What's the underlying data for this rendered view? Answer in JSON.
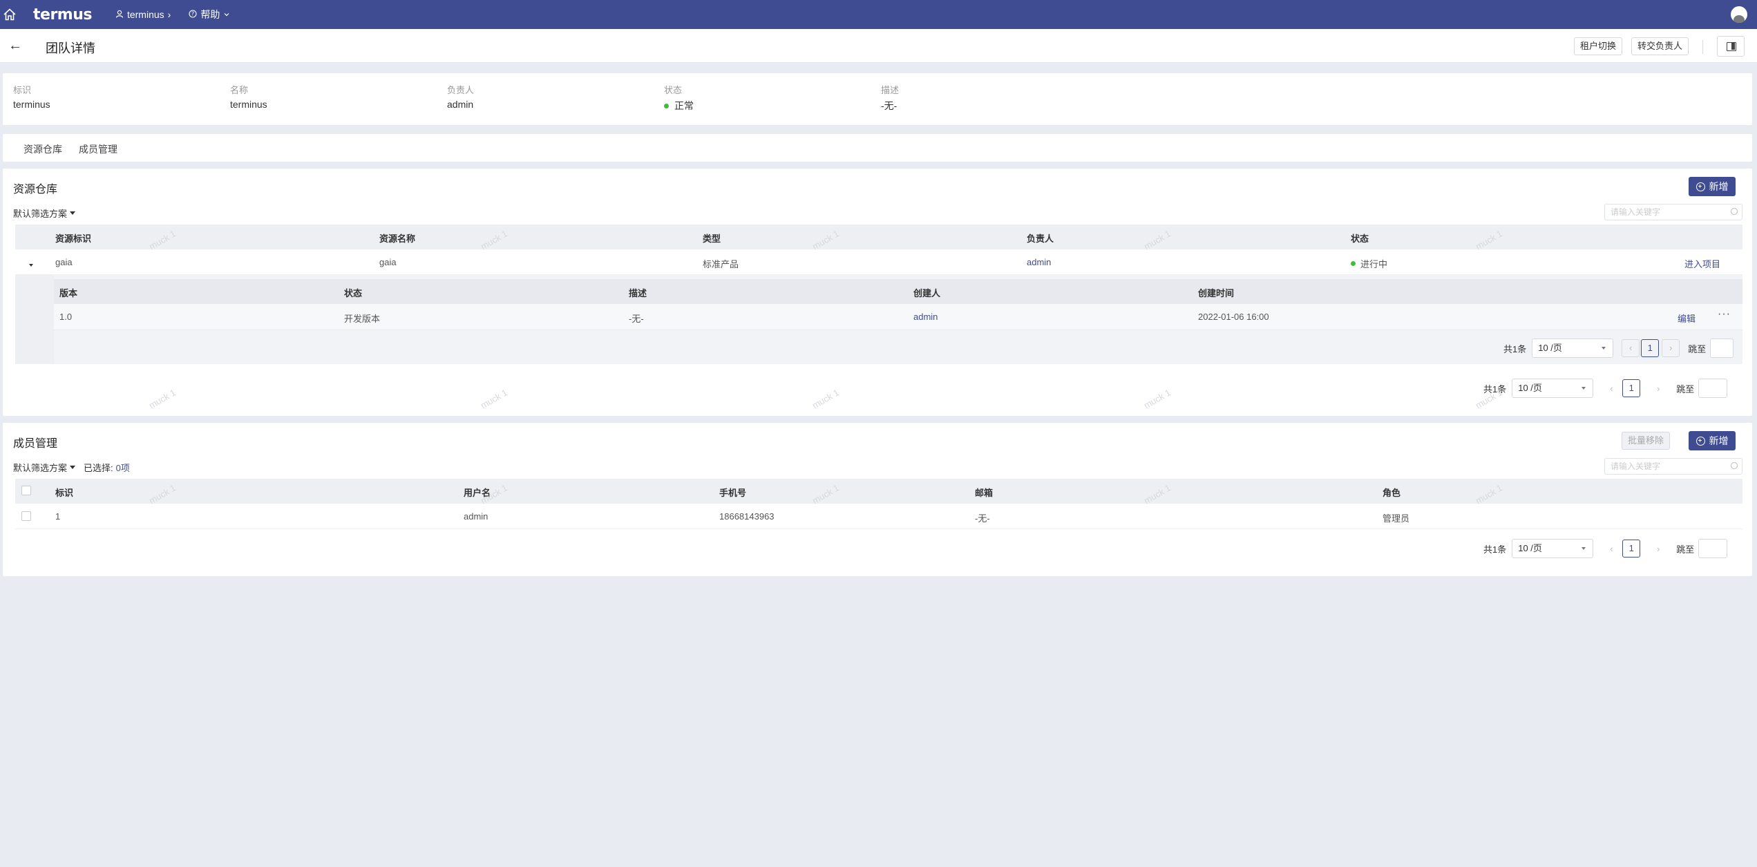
{
  "topbar": {
    "logo": "termus",
    "org": "terminus",
    "help": "帮助"
  },
  "header": {
    "title": "团队详情",
    "switch_tenant": "租户切换",
    "transfer_owner": "转交负责人"
  },
  "info": {
    "id_label": "标识",
    "id_value": "terminus",
    "name_label": "名称",
    "name_value": "terminus",
    "owner_label": "负责人",
    "owner_value": "admin",
    "status_label": "状态",
    "status_value": "正常",
    "desc_label": "描述",
    "desc_value": "-无-"
  },
  "tabs": [
    "资源仓库",
    "成员管理"
  ],
  "repo": {
    "title": "资源仓库",
    "add_label": "新增",
    "filter_label": "默认筛选方案",
    "search_placeholder": "请输入关键字",
    "columns": [
      "资源标识",
      "资源名称",
      "类型",
      "负责人",
      "状态"
    ],
    "rows": [
      {
        "id": "gaia",
        "name": "gaia",
        "type": "标准产品",
        "owner": "admin",
        "status": "进行中",
        "action": "进入项目"
      }
    ],
    "sub": {
      "columns": [
        "版本",
        "状态",
        "描述",
        "创建人",
        "创建时间"
      ],
      "rows": [
        {
          "version": "1.0",
          "status": "开发版本",
          "desc": "-无-",
          "creator": "admin",
          "created": "2022-01-06 16:00",
          "edit": "编辑",
          "more": "···"
        }
      ],
      "pager": {
        "total": "共1条",
        "size": "10 /页",
        "page": "1",
        "jump": "跳至"
      }
    },
    "pager": {
      "total": "共1条",
      "size": "10 /页",
      "page": "1",
      "jump": "跳至"
    }
  },
  "members": {
    "title": "成员管理",
    "batch_remove": "批量移除",
    "add_label": "新增",
    "filter_label": "默认筛选方案",
    "selected_label": "已选择:",
    "selected_count": "0项",
    "search_placeholder": "请输入关键字",
    "columns": [
      "标识",
      "用户名",
      "手机号",
      "邮箱",
      "角色"
    ],
    "rows": [
      {
        "id": "1",
        "username": "admin",
        "phone": "18668143963",
        "email": "-无-",
        "role": "管理员"
      }
    ],
    "pager": {
      "total": "共1条",
      "size": "10 /页",
      "page": "1",
      "jump": "跳至"
    }
  },
  "watermark": "muck 1",
  "colors": {
    "brand": "#3f4c91",
    "success": "#3dbd3d",
    "page_bg": "#e9ebf3"
  },
  "icons": [
    "home-icon",
    "user-icon",
    "help-icon",
    "chevron-down-icon",
    "back-arrow-icon",
    "panel-toggle-icon",
    "plus-circle-icon",
    "search-icon",
    "caret-down-icon",
    "expand-caret-icon"
  ]
}
